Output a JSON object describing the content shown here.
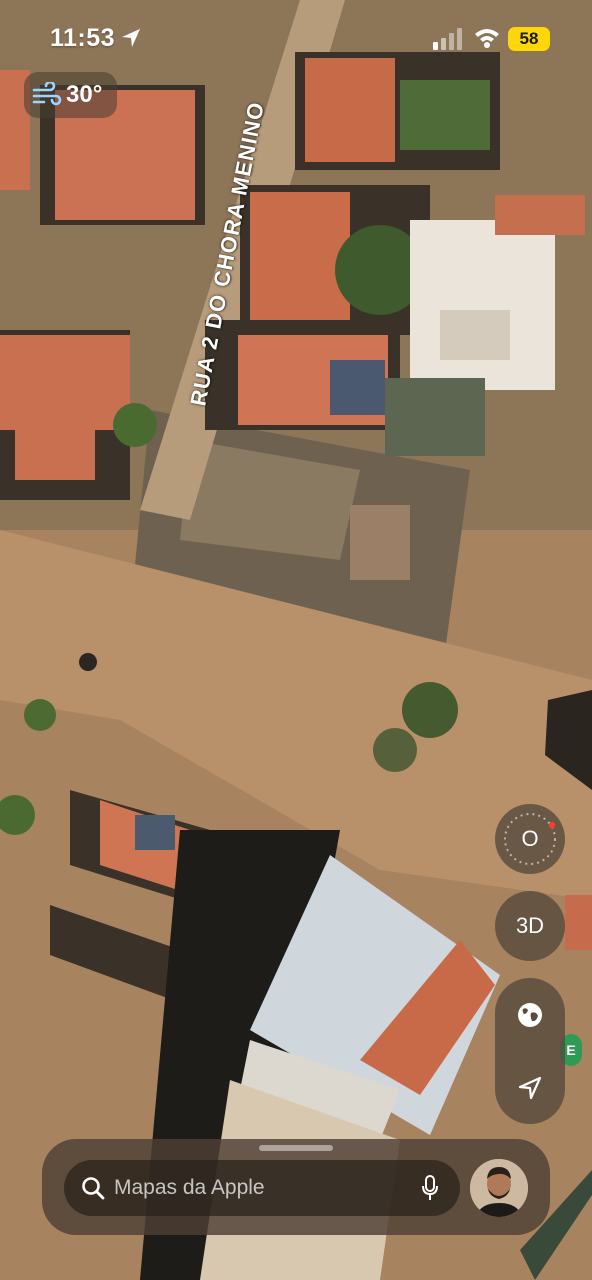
{
  "status_bar": {
    "time": "11:53",
    "battery": "58",
    "icons": [
      "location-arrow-icon",
      "cellular-signal-icon",
      "wifi-icon",
      "battery-icon"
    ]
  },
  "weather": {
    "icon": "wind-icon",
    "temperature": "30°"
  },
  "map": {
    "street_label": "RUA 2 DO CHORA MENINO",
    "poi_marker_letter": "E"
  },
  "controls": {
    "compass_label": "O",
    "view_3d_label": "3D",
    "icons": [
      "globe-icon",
      "location-arrow-icon"
    ]
  },
  "search": {
    "placeholder": "Mapas da Apple",
    "icons": [
      "search-icon",
      "microphone-icon"
    ]
  },
  "colors": {
    "battery": "#ffd60a",
    "compass_needle": "#ff3b30",
    "poi_green": "#2e9a53"
  }
}
